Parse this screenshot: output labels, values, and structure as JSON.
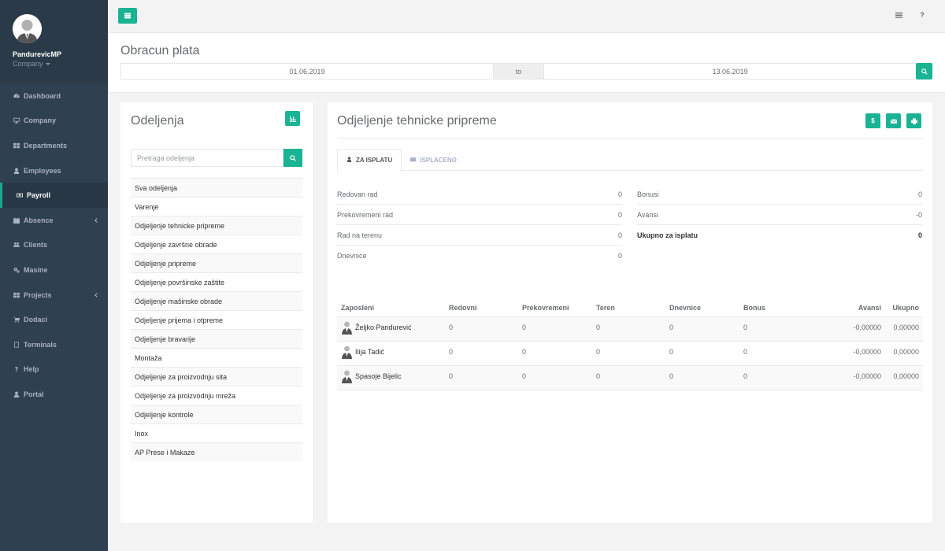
{
  "user": {
    "name": "PandurevicMP",
    "company": "Company"
  },
  "nav": [
    {
      "label": "Dashboard",
      "icon": "dashboard-icon",
      "arrow": false,
      "active": false
    },
    {
      "label": "Company",
      "icon": "monitor-icon",
      "arrow": false,
      "active": false
    },
    {
      "label": "Departments",
      "icon": "grid-icon",
      "arrow": false,
      "active": false
    },
    {
      "label": "Employees",
      "icon": "user-icon",
      "arrow": false,
      "active": false
    },
    {
      "label": "Payroll",
      "icon": "money-icon",
      "arrow": false,
      "active": true
    },
    {
      "label": "Absence",
      "icon": "calendar-icon",
      "arrow": true,
      "active": false
    },
    {
      "label": "Clients",
      "icon": "users-icon",
      "arrow": false,
      "active": false
    },
    {
      "label": "Masine",
      "icon": "gears-icon",
      "arrow": false,
      "active": false
    },
    {
      "label": "Projects",
      "icon": "grid-icon",
      "arrow": true,
      "active": false
    },
    {
      "label": "Dodaci",
      "icon": "cart-icon",
      "arrow": false,
      "active": false
    },
    {
      "label": "Terminals",
      "icon": "tablet-icon",
      "arrow": false,
      "active": false
    },
    {
      "label": "Help",
      "icon": "question-icon",
      "arrow": false,
      "active": false
    },
    {
      "label": "Portal",
      "icon": "user-icon",
      "arrow": false,
      "active": false
    }
  ],
  "topbar": {
    "help": "?"
  },
  "header": {
    "title": "Obracun plata",
    "date_from": "01.06.2019",
    "to_label": "to",
    "date_to": "13.06.2019"
  },
  "departments": {
    "title": "Odeljenja",
    "search_placeholder": "Pretraga odeljenja",
    "items": [
      "Sva odeljenja",
      "Varenje",
      "Odjeljenje tehnicke pripreme",
      "Odjeljenje završne obrade",
      "Odjeljenje pripreme",
      "Odjeljenje površinske zaštite",
      "Odjeljenje mašinske obrade",
      "Odjeljenje prijema i otpreme",
      "Odjeljenje bravarije",
      "Montaža",
      "Odjeljenje za proizvodnju sita",
      "Odjeljenje za proizvodnju mreža",
      "Odjeljenje kontrole",
      "Inox",
      "AP Prese i Makaze"
    ]
  },
  "detail": {
    "title": "Odjeljenje tehnicke pripreme",
    "dollar_label": "$",
    "tabs": [
      {
        "label": "ZA ISPLATU",
        "active": true
      },
      {
        "label": "ISPLACENO",
        "active": false
      }
    ],
    "summary_left": [
      {
        "label": "Redovan rad",
        "value": "0"
      },
      {
        "label": "Prekovremeni rad",
        "value": "0"
      },
      {
        "label": "Rad na terenu",
        "value": "0"
      },
      {
        "label": "Dnevnice",
        "value": "0"
      }
    ],
    "summary_right": [
      {
        "label": "Bonusi",
        "value": "0",
        "bold": false
      },
      {
        "label": "Avansi",
        "value": "-0",
        "bold": false
      },
      {
        "label": "Ukupno za isplatu",
        "value": "0",
        "bold": true
      }
    ],
    "columns": [
      "Zaposleni",
      "Redovni",
      "Prekovremeni",
      "Teren",
      "Dnevnice",
      "Bonus",
      "Avansi",
      "Ukupno"
    ],
    "rows": [
      {
        "name": "Željko Pandurević",
        "redovni": "0",
        "prekovremeni": "0",
        "teren": "0",
        "dnevnice": "0",
        "bonus": "0",
        "avansi": "-0,00000",
        "ukupno": "0,00000"
      },
      {
        "name": "Ilija Tadić",
        "redovni": "0",
        "prekovremeni": "0",
        "teren": "0",
        "dnevnice": "0",
        "bonus": "0",
        "avansi": "-0,00000",
        "ukupno": "0,00000"
      },
      {
        "name": "Spasoje Bijelic",
        "redovni": "0",
        "prekovremeni": "0",
        "teren": "0",
        "dnevnice": "0",
        "bonus": "0",
        "avansi": "-0,00000",
        "ukupno": "0,00000"
      }
    ]
  }
}
